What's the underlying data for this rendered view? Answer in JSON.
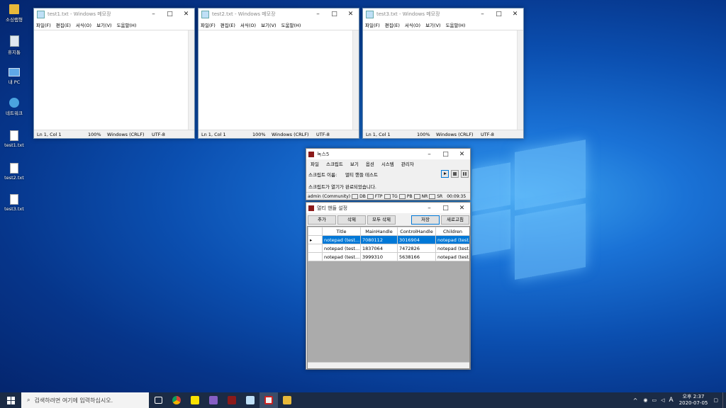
{
  "desktop": {
    "icons": [
      {
        "label": "소싱랩형",
        "icon": "folder-icon"
      },
      {
        "label": "휴지통",
        "icon": "recycle-bin-icon"
      },
      {
        "label": "내 PC",
        "icon": "this-pc-icon"
      },
      {
        "label": "네트워크",
        "icon": "network-icon"
      },
      {
        "label": "test1.txt",
        "icon": "text-file-icon"
      },
      {
        "label": "test2.txt",
        "icon": "text-file-icon"
      },
      {
        "label": "test3.txt",
        "icon": "text-file-icon"
      }
    ]
  },
  "notepad_menu": [
    "파일(F)",
    "편집(E)",
    "서식(O)",
    "보기(V)",
    "도움말(H)"
  ],
  "notepads": [
    {
      "title": "test1.txt - Windows 메모장",
      "pos": "Ln 1, Col 1",
      "zoom": "100%",
      "eol": "Windows (CRLF)",
      "enc": "UTF-8"
    },
    {
      "title": "test2.txt - Windows 메모장",
      "pos": "Ln 1, Col 1",
      "zoom": "100%",
      "eol": "Windows (CRLF)",
      "enc": "UTF-8"
    },
    {
      "title": "test3.txt - Windows 메모장",
      "pos": "Ln 1, Col 1",
      "zoom": "100%",
      "eol": "Windows (CRLF)",
      "enc": "UTF-8"
    }
  ],
  "nox": {
    "title": "녹스5",
    "menu": [
      "파일",
      "스크립트",
      "보기",
      "옵션",
      "시스템",
      "관리자"
    ],
    "script_label": "스크립트 이름:",
    "script_name": "멀티 핸들 테스트",
    "message": "스크립트가 열기가 완료되었습니다.",
    "status_user": "admin (Community)",
    "status_flags": [
      "DB",
      "FTP",
      "TG",
      "PB",
      "NR",
      "SR"
    ],
    "elapsed": "00:09:35"
  },
  "multi": {
    "title": "멀티 핸들 설정",
    "buttons": {
      "add": "추가",
      "delete": "삭제",
      "delete_all": "모두 삭제",
      "save": "저장",
      "refresh": "새로고침"
    },
    "columns": [
      "Title",
      "MainHandle",
      "ControlHandle",
      "Children"
    ],
    "rows": [
      {
        "title": "notepad  (test...",
        "main": "7080112",
        "control": "3016904",
        "children": "notepad  (test..."
      },
      {
        "title": "notepad  (test...",
        "main": "1837064",
        "control": "7472826",
        "children": "notepad  (test..."
      },
      {
        "title": "notepad  (test...",
        "main": "3999310",
        "control": "5638166",
        "children": "notepad  (test..."
      }
    ]
  },
  "taskbar": {
    "search_placeholder": "검색하려면 여기에 입력하십시오.",
    "apps": [
      "task-view-icon",
      "chrome-icon",
      "kakaotalk-icon",
      "visual-studio-icon",
      "red-app-icon",
      "notepad-icon",
      "nox-icon",
      "file-explorer-icon"
    ],
    "time": "오후 2:37",
    "date": "2020-07-05",
    "ime": "A"
  }
}
